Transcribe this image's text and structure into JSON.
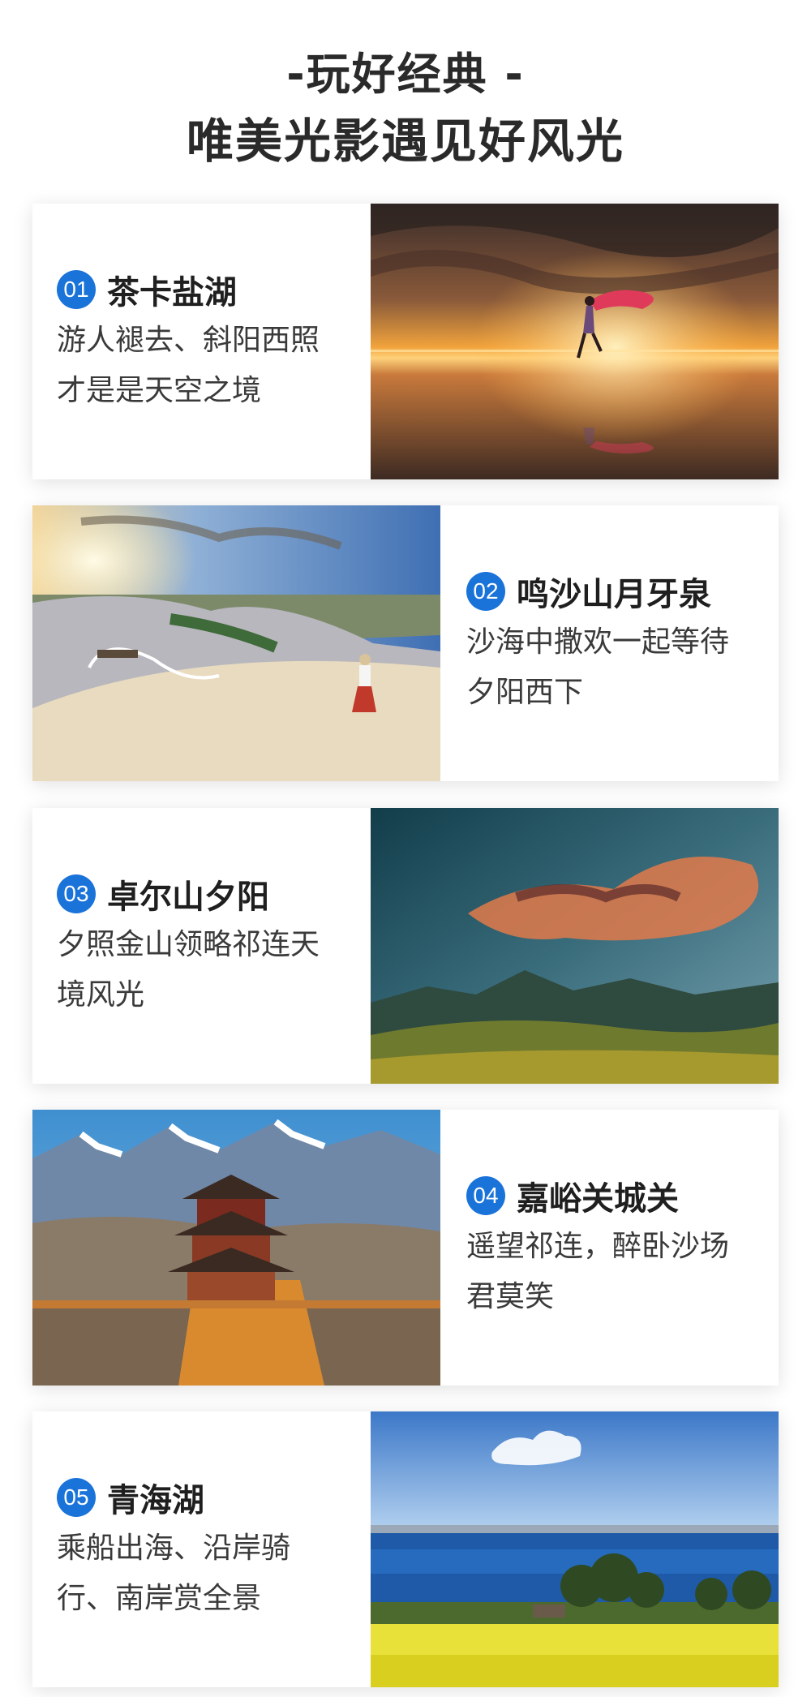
{
  "header": {
    "line1": "-玩好经典 -",
    "line2": "唯美光影遇见好风光"
  },
  "items": [
    {
      "num": "01",
      "title": "茶卡盐湖",
      "desc_line1": "游人褪去、斜阳西照",
      "desc_line2": "才是是天空之境",
      "photo_icon": "salt-lake-sunset-photo"
    },
    {
      "num": "02",
      "title": "鸣沙山月牙泉",
      "desc_line1": "沙海中撒欢一起等待",
      "desc_line2": "夕阳西下",
      "photo_icon": "desert-dune-photo"
    },
    {
      "num": "03",
      "title": "卓尔山夕阳",
      "desc_line1": "夕照金山领略祁连天",
      "desc_line2": "境风光",
      "photo_icon": "mountain-sunset-photo"
    },
    {
      "num": "04",
      "title": "嘉峪关城关",
      "desc_line1": "遥望祁连，醉卧沙场",
      "desc_line2": "君莫笑",
      "photo_icon": "fortress-tower-photo"
    },
    {
      "num": "05",
      "title": "青海湖",
      "desc_line1": "乘船出海、沿岸骑",
      "desc_line2": "行、南岸赏全景",
      "photo_icon": "lake-rapeseed-photo"
    }
  ],
  "colors": {
    "accent": "#1a73d9"
  }
}
